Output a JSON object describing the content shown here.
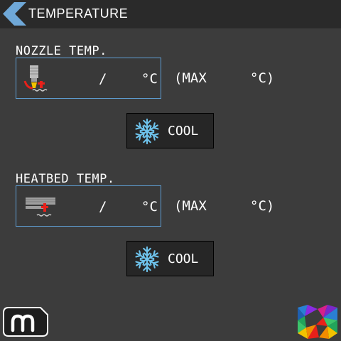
{
  "header": {
    "title": "TEMPERATURE",
    "back_icon": "chevron-left-icon"
  },
  "nozzle": {
    "label": "NOZZLE TEMP.",
    "current_value": "",
    "target_value": "",
    "separator": "/",
    "unit": "°C",
    "max_prefix": "(MAX",
    "max_value": "",
    "max_suffix": "°C)",
    "icon": "nozzle-icon",
    "cool_label": "COOL",
    "cool_icon": "snowflake-icon"
  },
  "heatbed": {
    "label": "HEATBED TEMP.",
    "current_value": "",
    "target_value": "",
    "separator": "/",
    "unit": "°C",
    "max_prefix": "(MAX",
    "max_value": "",
    "max_suffix": "°C)",
    "icon": "heatbed-icon",
    "cool_label": "COOL",
    "cool_icon": "snowflake-icon"
  },
  "footer": {
    "home_icon": "m-home-icon",
    "logo": "brand-logo"
  },
  "colors": {
    "background": "#3c3c3c",
    "header_bg": "#2a2a2a",
    "accent_blue": "#5f9fd4",
    "snowflake": "#6ec3ec",
    "heater_red": "#e8201a",
    "button_bg": "#262626"
  }
}
